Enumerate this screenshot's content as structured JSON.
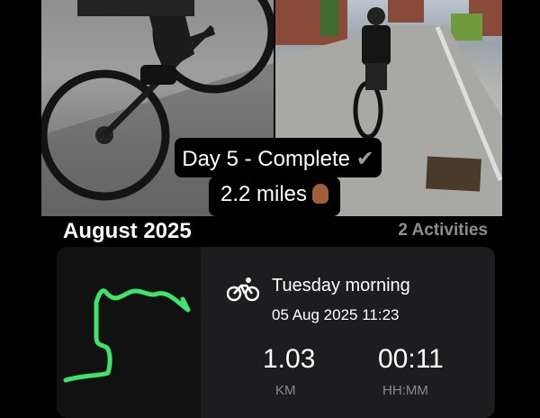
{
  "caption": {
    "line1": "Day 5 - Complete",
    "check_icon": "check-mark-icon",
    "line2": "2.2 miles",
    "hand_icon": "crossed-fingers-icon"
  },
  "summary": {
    "month": "August 2025",
    "activities": "2 Activities"
  },
  "activity": {
    "type_icon": "bicycle-icon",
    "name": "Tuesday morning",
    "datetime": "05 Aug 2025 11:23",
    "distance_value": "1.03",
    "distance_unit": "KM",
    "duration_value": "00:11",
    "duration_unit": "HH:MM",
    "route_color": "#3ee56b"
  }
}
